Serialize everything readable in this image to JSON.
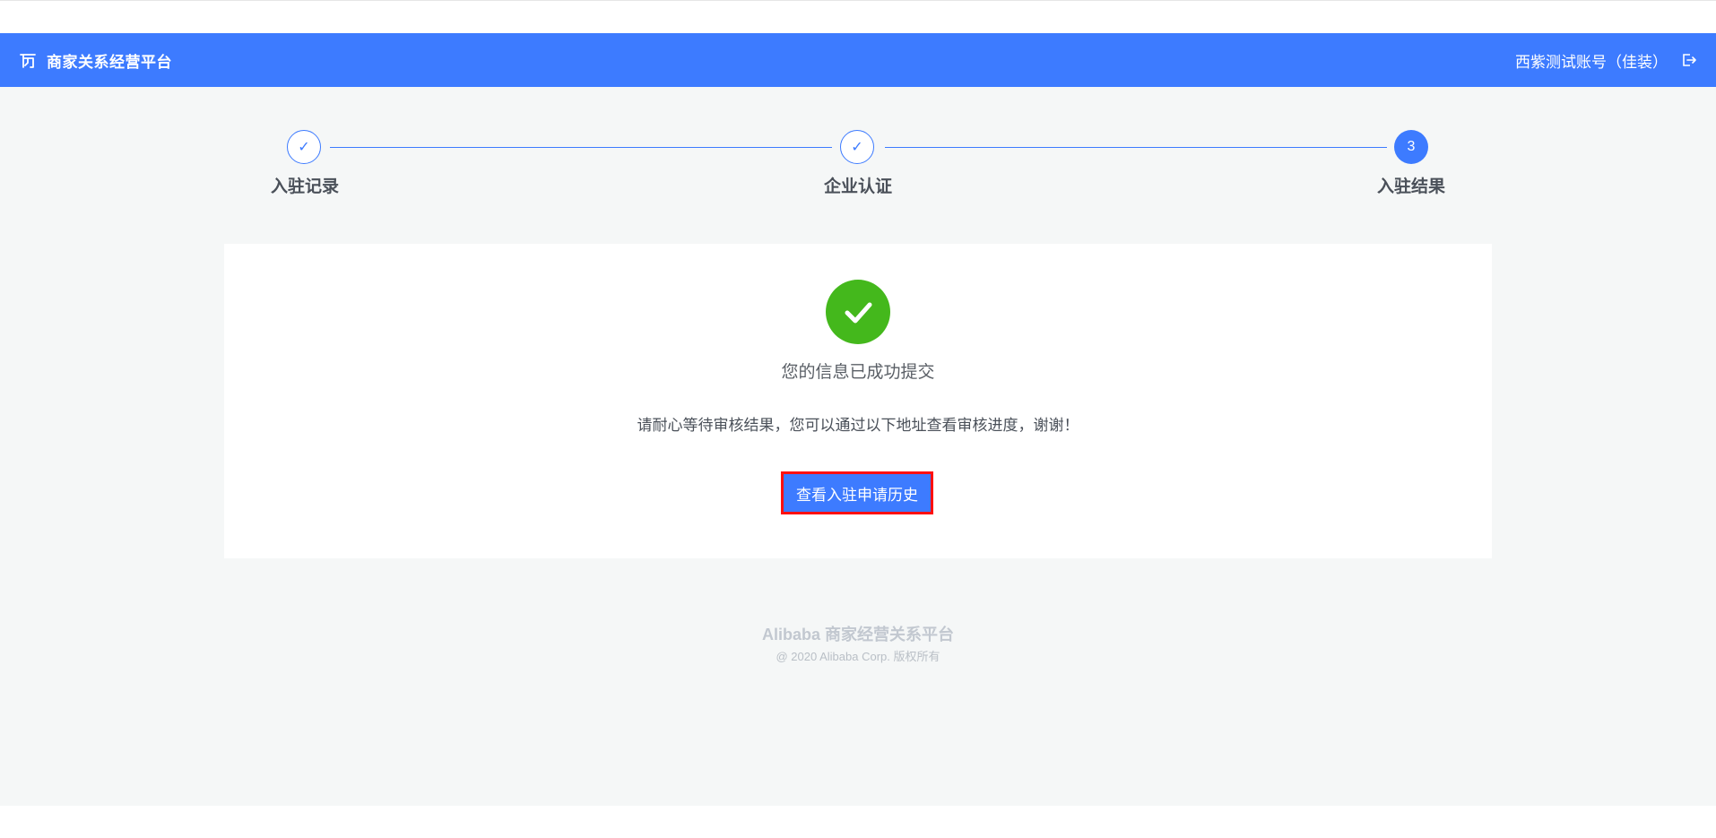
{
  "header": {
    "brand_title": "商家关系经营平台",
    "account_name": "西紫测试账号（佳装）"
  },
  "steps": [
    {
      "label": "入驻记录",
      "status": "done",
      "marker": "✓"
    },
    {
      "label": "企业认证",
      "status": "done",
      "marker": "✓"
    },
    {
      "label": "入驻结果",
      "status": "active",
      "marker": "3"
    }
  ],
  "result": {
    "title": "您的信息已成功提交",
    "description": "请耐心等待审核结果，您可以通过以下地址查看审核进度，谢谢！",
    "button_label": "查看入驻申请历史"
  },
  "footer": {
    "title": "Alibaba 商家经营关系平台",
    "copyright": "@ 2020 Alibaba Corp. 版权所有"
  },
  "colors": {
    "primary": "#3d7bff",
    "success": "#44b81c",
    "highlight_border": "#ff1010",
    "page_background": "#f5f7f7"
  }
}
